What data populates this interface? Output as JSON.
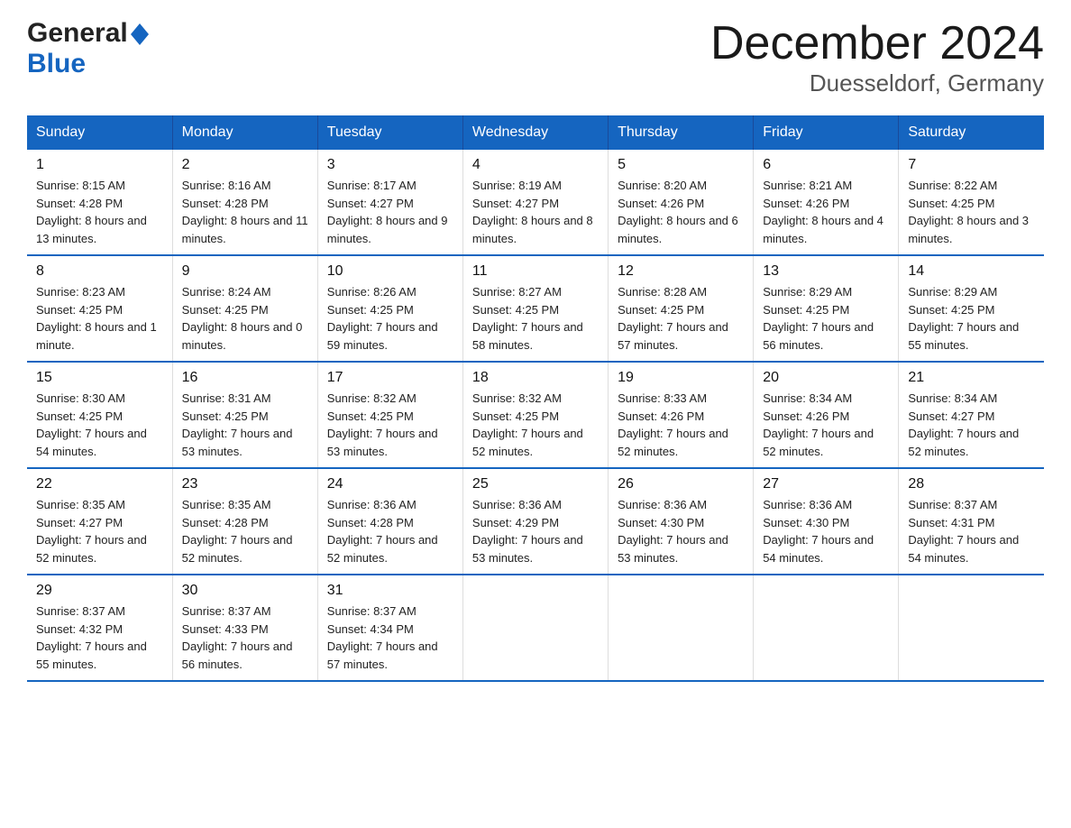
{
  "header": {
    "logo_general": "General",
    "logo_blue": "Blue",
    "title": "December 2024",
    "subtitle": "Duesseldorf, Germany"
  },
  "days_of_week": [
    "Sunday",
    "Monday",
    "Tuesday",
    "Wednesday",
    "Thursday",
    "Friday",
    "Saturday"
  ],
  "weeks": [
    [
      {
        "day": "1",
        "sunrise": "8:15 AM",
        "sunset": "4:28 PM",
        "daylight": "8 hours and 13 minutes."
      },
      {
        "day": "2",
        "sunrise": "8:16 AM",
        "sunset": "4:28 PM",
        "daylight": "8 hours and 11 minutes."
      },
      {
        "day": "3",
        "sunrise": "8:17 AM",
        "sunset": "4:27 PM",
        "daylight": "8 hours and 9 minutes."
      },
      {
        "day": "4",
        "sunrise": "8:19 AM",
        "sunset": "4:27 PM",
        "daylight": "8 hours and 8 minutes."
      },
      {
        "day": "5",
        "sunrise": "8:20 AM",
        "sunset": "4:26 PM",
        "daylight": "8 hours and 6 minutes."
      },
      {
        "day": "6",
        "sunrise": "8:21 AM",
        "sunset": "4:26 PM",
        "daylight": "8 hours and 4 minutes."
      },
      {
        "day": "7",
        "sunrise": "8:22 AM",
        "sunset": "4:25 PM",
        "daylight": "8 hours and 3 minutes."
      }
    ],
    [
      {
        "day": "8",
        "sunrise": "8:23 AM",
        "sunset": "4:25 PM",
        "daylight": "8 hours and 1 minute."
      },
      {
        "day": "9",
        "sunrise": "8:24 AM",
        "sunset": "4:25 PM",
        "daylight": "8 hours and 0 minutes."
      },
      {
        "day": "10",
        "sunrise": "8:26 AM",
        "sunset": "4:25 PM",
        "daylight": "7 hours and 59 minutes."
      },
      {
        "day": "11",
        "sunrise": "8:27 AM",
        "sunset": "4:25 PM",
        "daylight": "7 hours and 58 minutes."
      },
      {
        "day": "12",
        "sunrise": "8:28 AM",
        "sunset": "4:25 PM",
        "daylight": "7 hours and 57 minutes."
      },
      {
        "day": "13",
        "sunrise": "8:29 AM",
        "sunset": "4:25 PM",
        "daylight": "7 hours and 56 minutes."
      },
      {
        "day": "14",
        "sunrise": "8:29 AM",
        "sunset": "4:25 PM",
        "daylight": "7 hours and 55 minutes."
      }
    ],
    [
      {
        "day": "15",
        "sunrise": "8:30 AM",
        "sunset": "4:25 PM",
        "daylight": "7 hours and 54 minutes."
      },
      {
        "day": "16",
        "sunrise": "8:31 AM",
        "sunset": "4:25 PM",
        "daylight": "7 hours and 53 minutes."
      },
      {
        "day": "17",
        "sunrise": "8:32 AM",
        "sunset": "4:25 PM",
        "daylight": "7 hours and 53 minutes."
      },
      {
        "day": "18",
        "sunrise": "8:32 AM",
        "sunset": "4:25 PM",
        "daylight": "7 hours and 52 minutes."
      },
      {
        "day": "19",
        "sunrise": "8:33 AM",
        "sunset": "4:26 PM",
        "daylight": "7 hours and 52 minutes."
      },
      {
        "day": "20",
        "sunrise": "8:34 AM",
        "sunset": "4:26 PM",
        "daylight": "7 hours and 52 minutes."
      },
      {
        "day": "21",
        "sunrise": "8:34 AM",
        "sunset": "4:27 PM",
        "daylight": "7 hours and 52 minutes."
      }
    ],
    [
      {
        "day": "22",
        "sunrise": "8:35 AM",
        "sunset": "4:27 PM",
        "daylight": "7 hours and 52 minutes."
      },
      {
        "day": "23",
        "sunrise": "8:35 AM",
        "sunset": "4:28 PM",
        "daylight": "7 hours and 52 minutes."
      },
      {
        "day": "24",
        "sunrise": "8:36 AM",
        "sunset": "4:28 PM",
        "daylight": "7 hours and 52 minutes."
      },
      {
        "day": "25",
        "sunrise": "8:36 AM",
        "sunset": "4:29 PM",
        "daylight": "7 hours and 53 minutes."
      },
      {
        "day": "26",
        "sunrise": "8:36 AM",
        "sunset": "4:30 PM",
        "daylight": "7 hours and 53 minutes."
      },
      {
        "day": "27",
        "sunrise": "8:36 AM",
        "sunset": "4:30 PM",
        "daylight": "7 hours and 54 minutes."
      },
      {
        "day": "28",
        "sunrise": "8:37 AM",
        "sunset": "4:31 PM",
        "daylight": "7 hours and 54 minutes."
      }
    ],
    [
      {
        "day": "29",
        "sunrise": "8:37 AM",
        "sunset": "4:32 PM",
        "daylight": "7 hours and 55 minutes."
      },
      {
        "day": "30",
        "sunrise": "8:37 AM",
        "sunset": "4:33 PM",
        "daylight": "7 hours and 56 minutes."
      },
      {
        "day": "31",
        "sunrise": "8:37 AM",
        "sunset": "4:34 PM",
        "daylight": "7 hours and 57 minutes."
      },
      null,
      null,
      null,
      null
    ]
  ]
}
